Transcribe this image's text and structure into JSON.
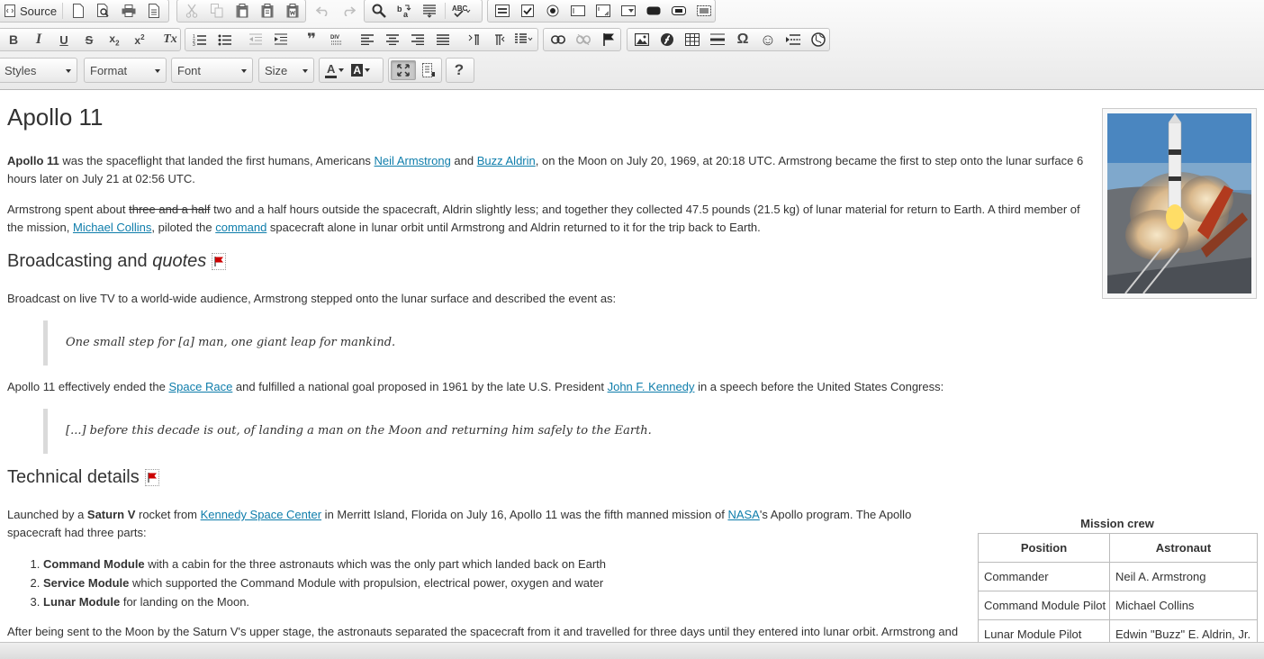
{
  "toolbar": {
    "source_label": "Source",
    "combos": {
      "styles": "Styles",
      "format": "Format",
      "font": "Font",
      "size": "Size"
    },
    "glyphs": {
      "bold": "B",
      "italic": "I",
      "underline": "U",
      "strike": "S",
      "subscript": "x",
      "subscript_mark": "2",
      "superscript": "x",
      "superscript_mark": "2",
      "remove_format": "Tx",
      "blockquote": "❞",
      "omega": "Ω",
      "smiley": "☺",
      "help": "?",
      "text_color": "A",
      "bg_color": "A"
    },
    "icons": [
      "source-icon",
      "new-page-icon",
      "preview-icon",
      "print-icon",
      "templates-icon",
      "cut-icon",
      "copy-icon",
      "paste-icon",
      "paste-text-icon",
      "paste-word-icon",
      "undo-icon",
      "redo-icon",
      "find-icon",
      "replace-icon",
      "select-all-icon",
      "spellcheck-icon",
      "form-icon",
      "checkbox-icon",
      "radio-icon",
      "textfield-icon",
      "textarea-icon",
      "select-icon",
      "button-icon",
      "hidden-field-icon",
      "numbered-list-icon",
      "bulleted-list-icon",
      "outdent-icon",
      "indent-icon",
      "blockquote-icon",
      "div-icon",
      "align-left-icon",
      "align-center-icon",
      "align-right-icon",
      "justify-icon",
      "ltr-icon",
      "rtl-icon",
      "language-icon",
      "link-icon",
      "unlink-icon",
      "anchor-icon",
      "image-icon",
      "flash-icon",
      "table-icon",
      "horizontal-rule-icon",
      "special-char-icon",
      "smiley-icon",
      "page-break-icon",
      "iframe-icon",
      "maximize-icon",
      "show-blocks-icon",
      "help-icon"
    ]
  },
  "article": {
    "title": "Apollo 11",
    "p1": {
      "strong": "Apollo 11",
      "t1": " was the spaceflight that landed the first humans, Americans ",
      "link1": "Neil Armstrong",
      "t2": " and ",
      "link2": "Buzz Aldrin",
      "t3": ", on the Moon on July 20, 1969, at 20:18 UTC. Armstrong became the first to step onto the lunar surface 6 hours later on July 21 at 02:56 UTC."
    },
    "p2": {
      "t1": "Armstrong spent about ",
      "struck": "three and a half",
      "t2": " two and a half hours outside the spacecraft, Aldrin slightly less; and together they collected 47.5 pounds (21.5 kg) of lunar material for return to Earth. A third member of the mission, ",
      "link1": "Michael Collins",
      "t3": ", piloted the ",
      "link2": "command",
      "t4": " spacecraft alone in lunar orbit until Armstrong and Aldrin returned to it for the trip back to Earth."
    },
    "h2_broadcast": "Broadcasting and ",
    "h2_broadcast_em": "quotes",
    "p3": "Broadcast on live TV to a world-wide audience, Armstrong stepped onto the lunar surface and described the event as:",
    "quote1": "One small step for [a] man, one giant leap for mankind.",
    "p4": {
      "t1": "Apollo 11 effectively ended the ",
      "link1": "Space Race",
      "t2": " and fulfilled a national goal proposed in 1961 by the late U.S. President ",
      "link2": "John F. Kennedy",
      "t3": " in a speech before the United States Congress:"
    },
    "quote2": "[...] before this decade is out, of landing a man on the Moon and returning him safely to the Earth.",
    "h2_tech": "Technical details",
    "p5": {
      "t1": "Launched by a ",
      "strong": "Saturn V",
      "t2": " rocket from ",
      "link1": "Kennedy Space Center",
      "t3": " in Merritt Island, Florida on July 16, Apollo 11 was the fifth manned mission of ",
      "link2": "NASA",
      "t4": "'s Apollo program. The Apollo spacecraft had three parts:"
    },
    "parts": [
      {
        "strong": "Command Module",
        "text": " with a cabin for the three astronauts which was the only part which landed back on Earth"
      },
      {
        "strong": "Service Module",
        "text": " which supported the Command Module with propulsion, electrical power, oxygen and water"
      },
      {
        "strong": "Lunar Module",
        "text": " for landing on the Moon."
      }
    ],
    "p6": "After being sent to the Moon by the Saturn V's upper stage, the astronauts separated the spacecraft from it and travelled for three days until they entered into lunar orbit. Armstrong and"
  },
  "crew_table": {
    "caption": "Mission crew",
    "headers": [
      "Position",
      "Astronaut"
    ],
    "rows": [
      [
        "Commander",
        "Neil A. Armstrong"
      ],
      [
        "Command Module Pilot",
        "Michael Collins"
      ],
      [
        "Lunar Module Pilot",
        "Edwin \"Buzz\" E. Aldrin, Jr."
      ]
    ]
  },
  "colors": {
    "link": "#0e7dab",
    "flag": "#cc0000",
    "toolbar_bg": "#e9e9e9"
  }
}
